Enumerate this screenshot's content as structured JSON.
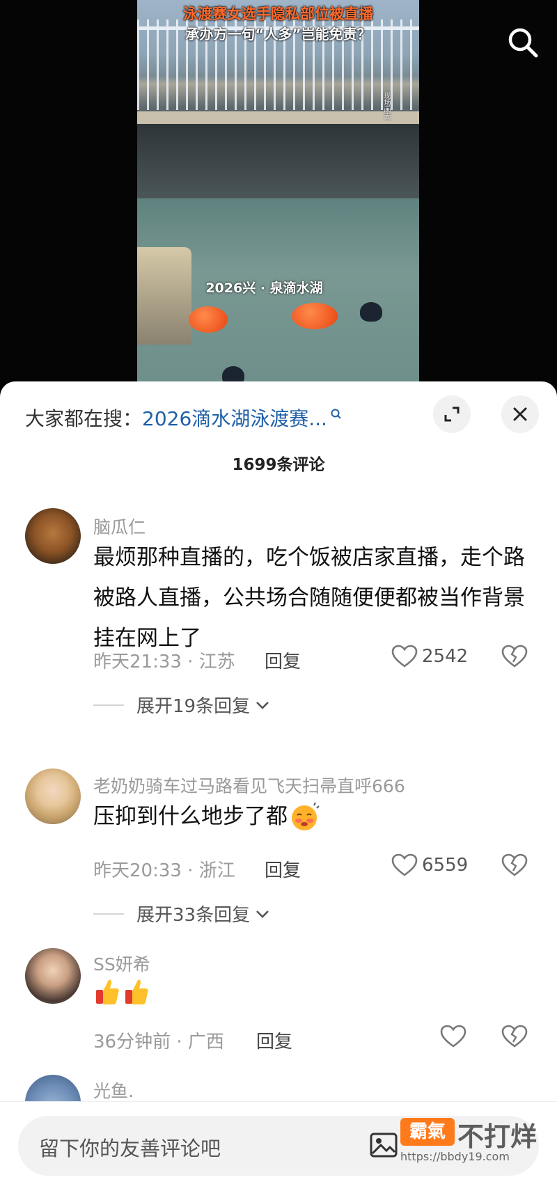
{
  "video": {
    "title_line1": "泳渡赛女选手隐私部位被直播",
    "title_line2": "承办方一句“人多”岂能免责？",
    "location_label": "2026兴 · 泉滴水湖",
    "side_tag": "现场画面"
  },
  "sheet": {
    "hot_prefix": "大家都在搜：",
    "hot_keyword": "2026滴水湖泳渡赛...",
    "comment_count": "1699条评论"
  },
  "comments": [
    {
      "user": "脑瓜仁",
      "text": "最烦那种直播的，吃个饭被店家直播，走个路被路人直播，公共场合随随便便都被当作背景挂在网上了",
      "time_loc": "昨天21:33 · 江苏",
      "reply_label": "回复",
      "likes": "2542",
      "expand": "展开19条回复"
    },
    {
      "user": "老奶奶骑车过马路看见飞天扫帚直呼666",
      "text": "压抑到什么地步了都",
      "time_loc": "昨天20:33 · 浙江",
      "reply_label": "回复",
      "likes": "6559",
      "expand": "展开33条回复"
    },
    {
      "user": "SS妍希",
      "text": "",
      "time_loc": "36分钟前 · 广西",
      "reply_label": "回复",
      "likes": ""
    },
    {
      "user": "光鱼."
    }
  ],
  "input": {
    "placeholder": "留下你的友善评论吧"
  },
  "watermark": {
    "logo": "霸氣",
    "text": "不打烊",
    "url": "https://bbdy19.com"
  }
}
